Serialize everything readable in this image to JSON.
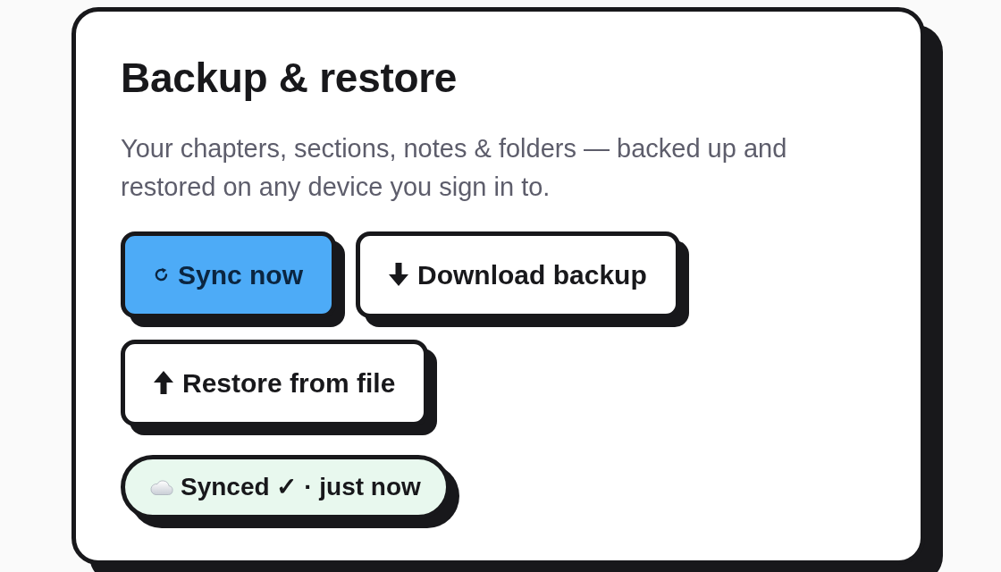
{
  "card": {
    "title": "Backup & restore",
    "description": "Your chapters, sections, notes & folders — backed up and restored on any device you sign in to."
  },
  "actions": [
    {
      "kind": "sync",
      "label": "Sync now",
      "primary": true
    },
    {
      "kind": "download",
      "label": "Download backup",
      "primary": false
    },
    {
      "kind": "upload",
      "label": "Restore from file",
      "primary": false
    }
  ],
  "status": {
    "kind": "synced",
    "label": "Synced ✓ · just now"
  }
}
